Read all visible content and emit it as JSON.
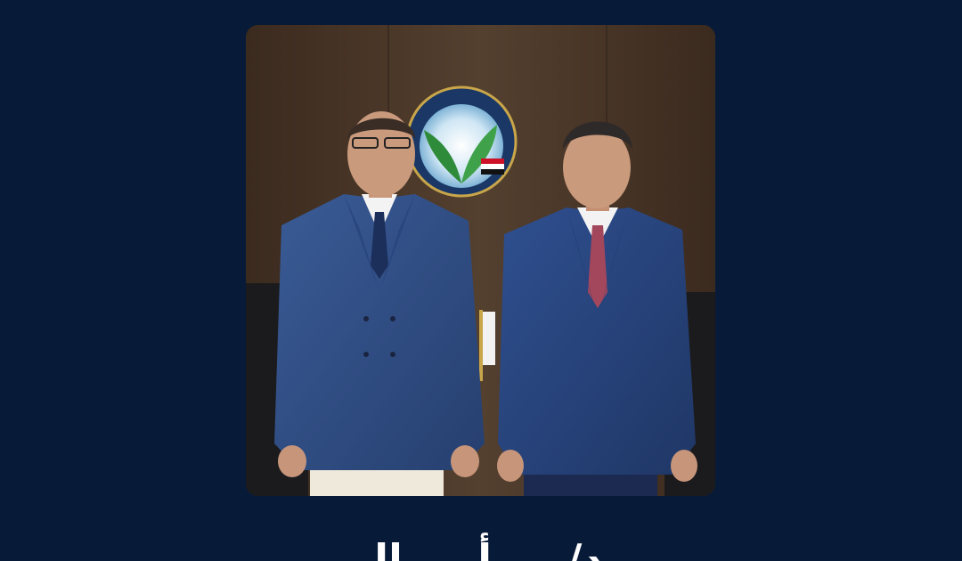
{
  "colors": {
    "background": "#071a38",
    "wood_panel": "#4a3628",
    "suit_blue": "#2f4f8a",
    "caption_text": "#ffffff"
  },
  "photo": {
    "subject": "Two men in blue suits standing in front of an emblem",
    "emblem_icon": "leaf-and-flag-emblem-icon"
  },
  "caption": {
    "text": "د/ ... أ ... الـ"
  }
}
